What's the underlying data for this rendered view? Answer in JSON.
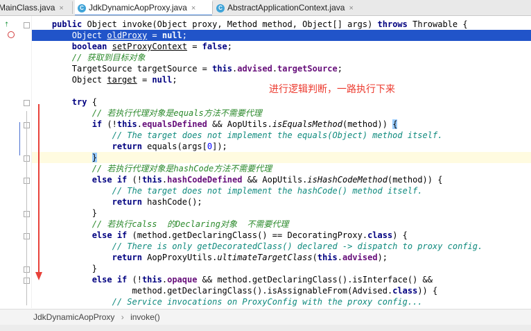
{
  "tabs": [
    {
      "label": "MainClass.java",
      "active": false
    },
    {
      "label": "JdkDynamicAopProxy.java",
      "active": true
    },
    {
      "label": "AbstractApplicationContext.java",
      "active": false
    }
  ],
  "tab_close_glyph": "×",
  "annotation": "进行逻辑判断，一路执行下来",
  "breadcrumb": {
    "cls": "JdkDynamicAopProxy",
    "sep": "›",
    "method": "invoke()"
  },
  "code": {
    "l1": {
      "a": "public ",
      "b": "Object invoke(Object proxy, Method method, Object[] args) ",
      "c": "throws ",
      "d": "Throwable {"
    },
    "l2": {
      "a": "Object ",
      "b": "oldProxy",
      "c": " = ",
      "d": "null",
      "e": ";"
    },
    "l3": {
      "a": "boolean ",
      "b": "setProxyContext",
      "c": " = ",
      "d": "false",
      "e": ";"
    },
    "l4": {
      "a": "// 获取到目标对象"
    },
    "l5": {
      "a": "TargetSource targetSource = ",
      "b": "this",
      "c": ".",
      "d": "advised",
      "e": ".",
      "f": "targetSource",
      "g": ";"
    },
    "l6": {
      "a": "Object ",
      "b": "target",
      "c": " = ",
      "d": "null",
      "e": ";"
    },
    "l8": {
      "a": "try ",
      "b": "{"
    },
    "l9": {
      "a": "// 若执行代理对象是equals方法不需要代理"
    },
    "l10": {
      "a": "if ",
      "b": "(!",
      "c": "this",
      "d": ".",
      "e": "equalsDefined",
      "f": " && AopUtils.",
      "g": "isEqualsMethod",
      "h": "(method)) ",
      "i": "{"
    },
    "l11": {
      "a": "// The target does not implement the equals(Object) method itself."
    },
    "l12": {
      "a": "return ",
      "b": "equals(args[",
      "c": "0",
      "d": "]);"
    },
    "l13": {
      "a": "}"
    },
    "l14": {
      "a": "// 若执行代理对象是hashCode方法不需要代理"
    },
    "l15": {
      "a": "else if ",
      "b": "(!",
      "c": "this",
      "d": ".",
      "e": "hashCodeDefined",
      "f": " && AopUtils.",
      "g": "isHashCodeMethod",
      "h": "(method)) {"
    },
    "l16": {
      "a": "// The target does not implement the hashCode() method itself."
    },
    "l17": {
      "a": "return ",
      "b": "hashCode();"
    },
    "l18": {
      "a": "}"
    },
    "l19": {
      "a": "// 若执行calss  的Declaring对象  不需要代理"
    },
    "l20": {
      "a": "else if ",
      "b": "(method.getDeclaringClass() == DecoratingProxy.",
      "c": "class",
      "d": ") {"
    },
    "l21": {
      "a": "// There is only getDecoratedClass() declared -> dispatch to proxy config."
    },
    "l22": {
      "a": "return ",
      "b": "AopProxyUtils.",
      "c": "ultimateTargetClass",
      "d": "(",
      "e": "this",
      "f": ".",
      "g": "advised",
      "h": ");"
    },
    "l23": {
      "a": "}"
    },
    "l24": {
      "a": "else if ",
      "b": "(!",
      "c": "this",
      "d": ".",
      "e": "opaque",
      "f": " && method.getDeclaringClass().isInterface() &&"
    },
    "l25": {
      "a": "method.getDeclaringClass().isAssignableFrom(Advised.",
      "b": "class",
      "c": ")) {"
    },
    "l26": {
      "a": "// Service invocations on ProxyConfig with the proxy config..."
    }
  },
  "colors": {
    "selection": "#2154c9",
    "annotation": "#ec3a2e",
    "keyword": "#000080",
    "field": "#660e7a"
  }
}
